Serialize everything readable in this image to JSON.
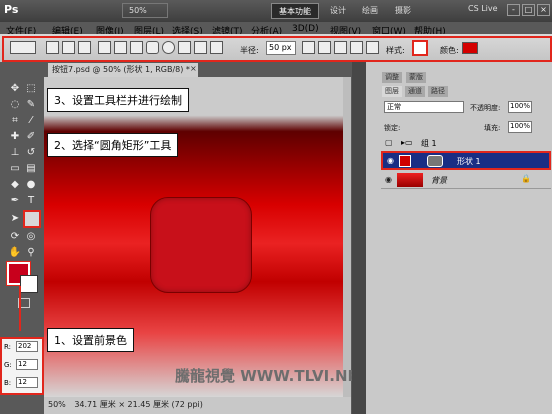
{
  "menubar": {
    "logo": "Ps",
    "items": [
      "文件(F)",
      "编辑(E)",
      "图像(I)",
      "图层(L)",
      "选择(S)",
      "滤镜(T)",
      "分析(A)",
      "3D(D)",
      "视图(V)",
      "窗口(W)",
      "帮助(H)"
    ],
    "zoom": "50%",
    "workspace": "基本功能",
    "workspace_items": [
      "设计",
      "绘画",
      "摄影"
    ],
    "cslive": "CS Live",
    "win_buttons": [
      "-",
      "□",
      "×"
    ]
  },
  "options": {
    "radius_label": "半径:",
    "radius_value": "50 px",
    "style_label": "样式:",
    "color_label": "颜色:",
    "color_value": "#d40000"
  },
  "document": {
    "tab_title": "按钮7.psd @ 50% (形状 1, RGB/8) *",
    "tab_close": "×",
    "status_zoom": "50%",
    "status_text": "34.71 厘米 × 21.45 厘米 (72 ppi)",
    "watermark": "騰龍視覺 WWW.TLVI.NET"
  },
  "callouts": {
    "step3": "3、设置工具栏并进行绘制",
    "step2": "2、选择“圆角矩形”工具",
    "step1": "1、设置前景色"
  },
  "color_picker": {
    "r_label": "R:",
    "r": "202",
    "g_label": "G:",
    "g": "12",
    "b_label": "B:",
    "b": "12",
    "fg": "#ca0c0c"
  },
  "layers_panel": {
    "tabs_top": [
      "调整",
      "蒙版"
    ],
    "tabs": [
      "图层",
      "通道",
      "路径"
    ],
    "blend_mode": "正常",
    "opacity_label": "不透明度:",
    "opacity": "100%",
    "lock_label": "锁定:",
    "fill_label": "填充:",
    "fill": "100%",
    "layers": [
      {
        "name": "组 1"
      },
      {
        "name": "形状 1"
      },
      {
        "name": "背景"
      }
    ]
  }
}
